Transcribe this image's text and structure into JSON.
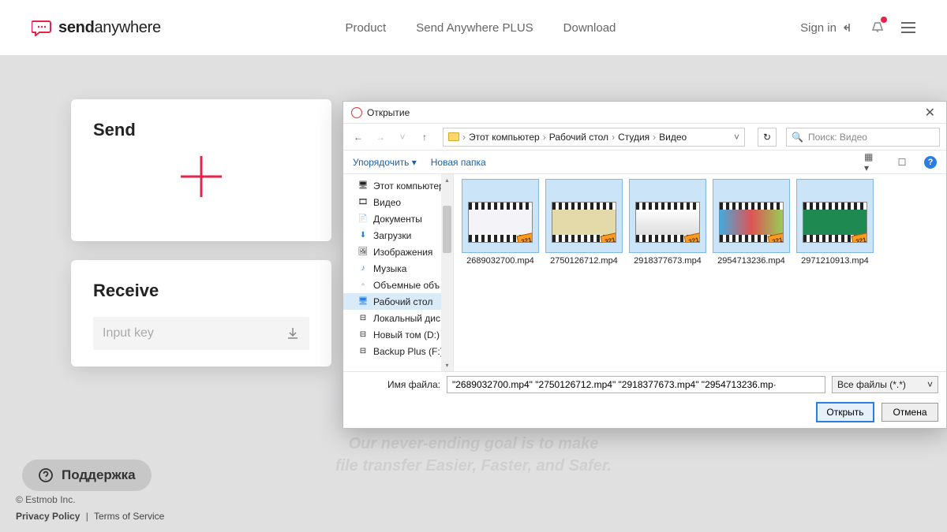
{
  "header": {
    "logo_bold": "send",
    "logo_rest": "anywhere",
    "nav": [
      "Product",
      "Send Anywhere PLUS",
      "Download"
    ],
    "signin": "Sign in"
  },
  "send": {
    "title": "Send"
  },
  "receive": {
    "title": "Receive",
    "placeholder": "Input key"
  },
  "tagline_l1": "Our never-ending goal is to make",
  "tagline_l2": "file transfer Easier, Faster, and Safer.",
  "support": "Поддержка",
  "footer": {
    "copyright": "© Estmob Inc.",
    "pp": "Privacy Policy",
    "sep": "|",
    "tos": "Terms of Service"
  },
  "dialog": {
    "title": "Открытие",
    "crumbs": [
      "Этот компьютер",
      "Рабочий стол",
      "Студия",
      "Видео"
    ],
    "search_placeholder": "Поиск: Видео",
    "toolbar": {
      "organize": "Упорядочить ▾",
      "newfolder": "Новая папка"
    },
    "tree": [
      {
        "label": "Этот компьютер",
        "icon": "ic-pc"
      },
      {
        "label": "Видео",
        "icon": "ic-vid"
      },
      {
        "label": "Документы",
        "icon": "ic-doc"
      },
      {
        "label": "Загрузки",
        "icon": "ic-dl"
      },
      {
        "label": "Изображения",
        "icon": "ic-img"
      },
      {
        "label": "Музыка",
        "icon": "ic-mus"
      },
      {
        "label": "Объемные объ",
        "icon": "ic-3d"
      },
      {
        "label": "Рабочий стол",
        "icon": "ic-desk",
        "selected": true
      },
      {
        "label": "Локальный дис",
        "icon": "ic-disk"
      },
      {
        "label": "Новый том (D:)",
        "icon": "ic-disk"
      },
      {
        "label": "Backup Plus   (F:)",
        "icon": "ic-disk"
      }
    ],
    "files": [
      {
        "name": "2689032700.mp4",
        "fill": "#f4f4f8"
      },
      {
        "name": "2750126712.mp4",
        "fill": "#e4d9a8"
      },
      {
        "name": "2918377673.mp4",
        "fill": "linear-gradient(#fff,#ddd)"
      },
      {
        "name": "2954713236.mp4",
        "fill": "linear-gradient(90deg,#4ad,#d55,#9c5)"
      },
      {
        "name": "2971210913.mp4",
        "fill": "#1e8a52"
      }
    ],
    "filename_label": "Имя файла:",
    "filename_value": "\"2689032700.mp4\" \"2750126712.mp4\" \"2918377673.mp4\" \"2954713236.mp·",
    "filetype": "Все файлы (*.*)",
    "open": "Открыть",
    "cancel": "Отмена"
  }
}
